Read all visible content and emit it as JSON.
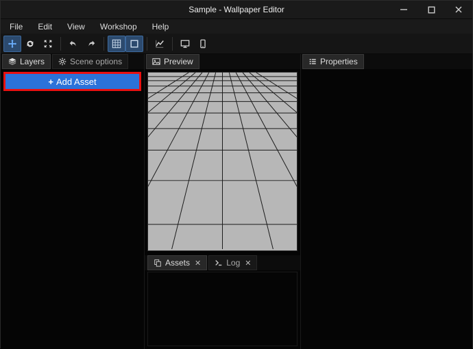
{
  "titlebar": {
    "title": "Sample - Wallpaper Editor"
  },
  "menu": {
    "file": "File",
    "edit": "Edit",
    "view": "View",
    "workshop": "Workshop",
    "help": "Help"
  },
  "left": {
    "tab_layers": "Layers",
    "tab_scene_options": "Scene options",
    "add_asset": "Add Asset"
  },
  "mid": {
    "tab_preview": "Preview",
    "tab_assets": "Assets",
    "tab_log": "Log"
  },
  "right": {
    "tab_properties": "Properties"
  },
  "toolbar": {
    "icons": {
      "move": "move-icon",
      "refresh": "refresh-icon",
      "expand": "expand-icon",
      "undo": "undo-icon",
      "redo": "redo-icon",
      "grid": "grid-icon",
      "box": "box-icon",
      "chart": "chart-icon",
      "monitor": "monitor-icon",
      "phone": "phone-icon"
    }
  },
  "colors": {
    "accent_blue": "#2b72d9",
    "highlight_red": "#e91010",
    "panel_bg": "#050505"
  }
}
